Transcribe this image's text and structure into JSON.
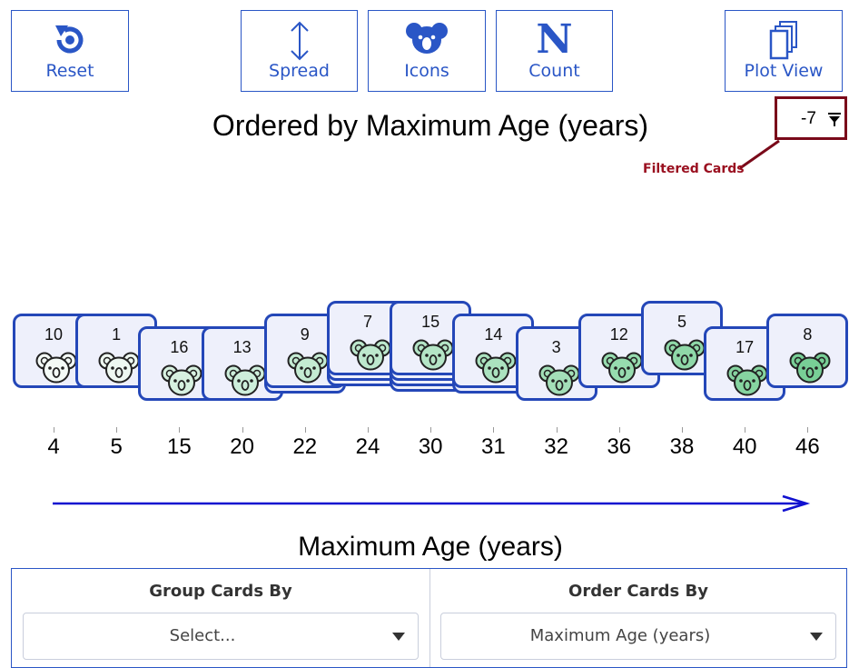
{
  "toolbar": {
    "reset_label": "Reset",
    "spread_label": "Spread",
    "icons_label": "Icons",
    "count_label": "Count",
    "plotview_label": "Plot View",
    "count_glyph": "N",
    "accent_color": "#2a56c6"
  },
  "title": "Ordered by Maximum Age (years)",
  "filter": {
    "count": "-7",
    "annotation": "Filtered Cards",
    "annotation_color": "#9a1020"
  },
  "cards": [
    {
      "id": "10",
      "age": "4",
      "shade": "#f4faf6",
      "stack": 1,
      "drop": 0
    },
    {
      "id": "1",
      "age": "5",
      "shade": "#eef8f1",
      "stack": 1,
      "drop": 0
    },
    {
      "id": "16",
      "age": "15",
      "shade": "#d7f1e0",
      "stack": 1,
      "drop": 1
    },
    {
      "id": "13",
      "age": "20",
      "shade": "#cdeedb",
      "stack": 1,
      "drop": 1
    },
    {
      "id": "9",
      "age": "22",
      "shade": "#c4ebd2",
      "stack": 2,
      "drop": 0
    },
    {
      "id": "7",
      "age": "24",
      "shade": "#bde8cd",
      "stack": 3,
      "drop": -1
    },
    {
      "id": "15",
      "age": "30",
      "shade": "#b4e5c6",
      "stack": 4,
      "drop": -1
    },
    {
      "id": "14",
      "age": "31",
      "shade": "#abe2bf",
      "stack": 2,
      "drop": 0
    },
    {
      "id": "3",
      "age": "32",
      "shade": "#a3dfb8",
      "stack": 1,
      "drop": 1
    },
    {
      "id": "12",
      "age": "36",
      "shade": "#97dcaf",
      "stack": 1,
      "drop": 0
    },
    {
      "id": "5",
      "age": "38",
      "shade": "#8fd8a8",
      "stack": 1,
      "drop": -1
    },
    {
      "id": "17",
      "age": "40",
      "shade": "#86d4a0",
      "stack": 1,
      "drop": 1
    },
    {
      "id": "8",
      "age": "46",
      "shade": "#78cf96",
      "stack": 1,
      "drop": 0
    }
  ],
  "x_axis_title": "Maximum Age (years)",
  "controls": {
    "group_label": "Group Cards By",
    "group_value": "Select...",
    "order_label": "Order Cards By",
    "order_value": "Maximum Age (years)"
  }
}
